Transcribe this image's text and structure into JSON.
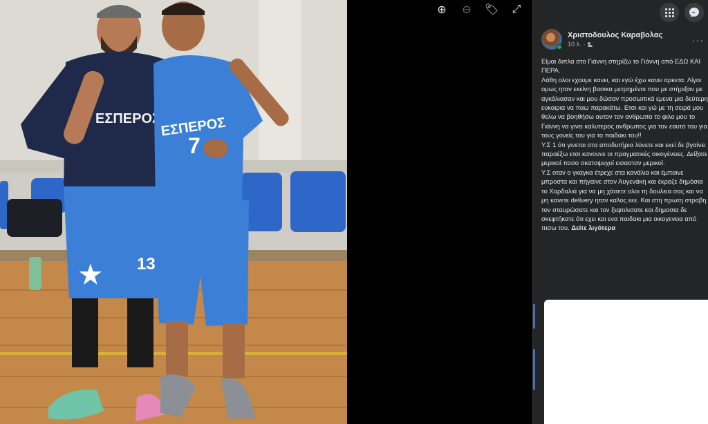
{
  "viewer": {
    "tools": [
      {
        "name": "zoom-in-icon",
        "glyph": "⊕"
      },
      {
        "name": "zoom-out-icon",
        "glyph": "⊖"
      },
      {
        "name": "tag-icon",
        "glyph": "🏷"
      },
      {
        "name": "fullscreen-icon",
        "glyph": "⤢"
      }
    ]
  },
  "photo": {
    "shirt_left_text": "ΕΣΠΕΡΟΣ",
    "shirt_right_text": "ΕΣΠΕΡΟΣ",
    "jersey_number": "7",
    "shorts_number": "13",
    "colors": {
      "jersey": "#3c7fd6",
      "navy": "#1f2a4a",
      "seat": "#2f67c9"
    }
  },
  "header": {
    "menu_icon": "grid-menu-icon",
    "messenger_icon": "messenger-icon"
  },
  "post": {
    "author": "Χριστοδουλος Καραβολας",
    "time": "10 λ.",
    "audience_icon": "friends-icon",
    "more_label": "···",
    "body": "Είμαι διπλα στο Γιάννη στηρίζω το Γιάννη από ΕΔΩ ΚΑΙ ΠΕΡΑ.\nΛάθη ολοι εχουμε κανει, και εγώ έχω κανει αρκετα. Λίγοι ομως ηταν εκείνη βασικα μετρημένοι που με στήριξαν με αγκάλιασαν και μου δώσαν προσωπικά εμενα μια δεύτερη ευκαιρια να παω παρακάτω. Ετσι και γώ με τη σειρά μου θελω να βοηθήσω αυτον τον ανθρωπο το φιλο μου το Γιάννη να γινει καλυτερος ανθρωπος για τον εαυτό του για τους γονείς του για το παιδακι του!!\nΥ.Σ 1 ότι γινεται στα αποδυτήρια λύνετε και εκεί δε βγαίνει παραέξω ετσι κανουνε οι πραγματικές οικογένειες. Δείξατε μερικοί ποσο σκατοψυχοί εισασταν μερικοί.\nΥ.Σ οταν ο γκαγκα έτρεχε στα κανάλια και έμπαινε μπροστα και πήγαινε στον Αυγενάκη και έκραζε δημόσια το Χαρδαλιά για να μη χάσετε ολοι τη δουλεια σας και να μη κανετε delivery ηταν καλος εεε. Και στη πρωτη στραβη τον σταυρώσατε και τον ξεφτιλισατε και δημοσια δε σκεφτήκατε ότι εχει και ενα παιδακι μια οικογενεια από πισω του.",
    "see_more": "Δείτε λιγότερα"
  }
}
